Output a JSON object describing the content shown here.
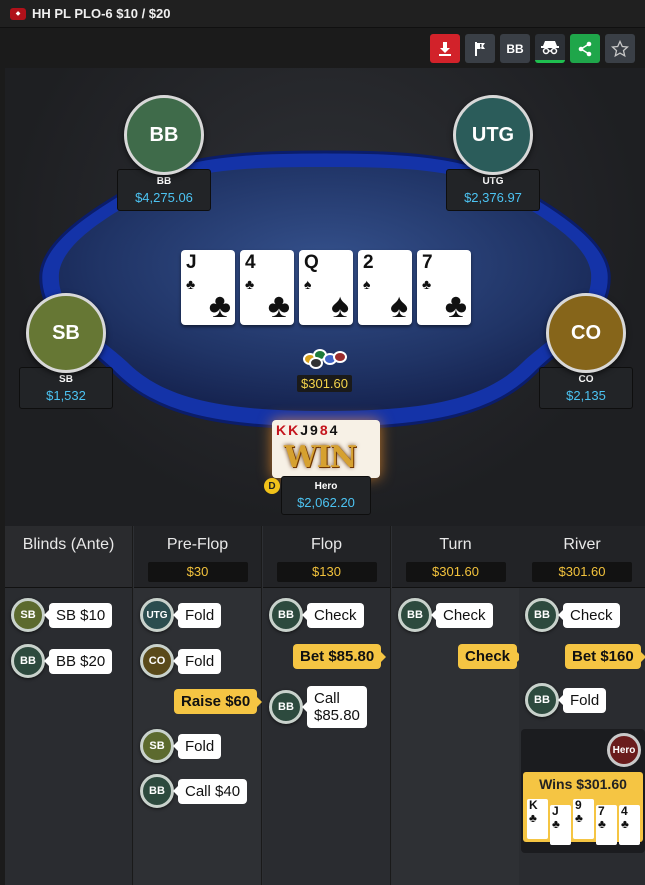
{
  "window": {
    "title": "HH PL PLO-6 $10 / $20"
  },
  "toolbar": {
    "buttons": [
      {
        "name": "download-icon",
        "label": ""
      },
      {
        "name": "flag-icon",
        "label": ""
      },
      {
        "name": "bb-toggle",
        "label": "BB"
      },
      {
        "name": "incognito-icon",
        "label": ""
      },
      {
        "name": "share-icon",
        "label": ""
      },
      {
        "name": "star-icon",
        "label": ""
      }
    ]
  },
  "seats": {
    "bb": {
      "avatar": "BB",
      "name": "BB",
      "stack": "$4,275.06",
      "color": "#3f6b4a"
    },
    "utg": {
      "avatar": "UTG",
      "name": "UTG",
      "stack": "$2,376.97",
      "color": "#2b5c5a"
    },
    "sb": {
      "avatar": "SB",
      "name": "SB",
      "stack": "$1,532",
      "color": "#667734"
    },
    "co": {
      "avatar": "CO",
      "name": "CO",
      "stack": "$2,135",
      "color": "#86651a"
    },
    "hero": {
      "name": "Hero",
      "stack": "$2,062.20"
    }
  },
  "board": [
    {
      "rank": "J",
      "suit": "♣"
    },
    {
      "rank": "4",
      "suit": "♣"
    },
    {
      "rank": "Q",
      "suit": "♠"
    },
    {
      "rank": "2",
      "suit": "♠"
    },
    {
      "rank": "7",
      "suit": "♣"
    }
  ],
  "pot": "$301.60",
  "hero_hand": {
    "ranks": [
      "K",
      "K",
      "J",
      "9",
      "8",
      "4"
    ],
    "win_text": "WIN"
  },
  "dealer_button": "D",
  "history": {
    "columns": [
      {
        "title": "Blinds (Ante)",
        "pot": ""
      },
      {
        "title": "Pre-Flop",
        "pot": "$30"
      },
      {
        "title": "Flop",
        "pot": "$130"
      },
      {
        "title": "Turn",
        "pot": "$301.60"
      },
      {
        "title": "River",
        "pot": "$301.60"
      }
    ],
    "blinds": [
      {
        "pos": "SB",
        "action": "SB $10"
      },
      {
        "pos": "BB",
        "action": "BB $20"
      }
    ],
    "preflop": [
      {
        "pos": "UTG",
        "action": "Fold"
      },
      {
        "pos": "CO",
        "action": "Fold"
      },
      {
        "pos": "",
        "action": "Raise $60"
      },
      {
        "pos": "SB",
        "action": "Fold"
      },
      {
        "pos": "BB",
        "action": "Call $40"
      }
    ],
    "flop": [
      {
        "pos": "BB",
        "action": "Check"
      },
      {
        "pos": "",
        "action": "Bet $85.80"
      },
      {
        "pos": "BB",
        "action": "Call\n$85.80"
      }
    ],
    "turn": [
      {
        "pos": "BB",
        "action": "Check"
      },
      {
        "pos": "",
        "action": "Check"
      }
    ],
    "river": [
      {
        "pos": "BB",
        "action": "Check"
      },
      {
        "pos": "",
        "action": "Bet $160"
      },
      {
        "pos": "BB",
        "action": "Fold"
      }
    ],
    "result": {
      "badge": "Hero",
      "wins": "Wins $301.60",
      "cards": [
        {
          "rank": "K",
          "suit": "♣"
        },
        {
          "rank": "J",
          "suit": "♣"
        },
        {
          "rank": "9",
          "suit": "♣"
        },
        {
          "rank": "7",
          "suit": "♣"
        },
        {
          "rank": "4",
          "suit": "♣"
        }
      ]
    }
  }
}
